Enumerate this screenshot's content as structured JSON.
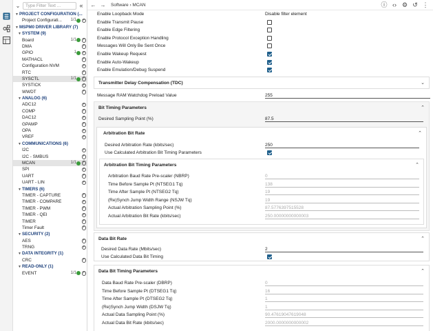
{
  "activity": {
    "icons": [
      "config-icon",
      "components-icon",
      "board-icon"
    ]
  },
  "sidebar": {
    "filter_placeholder": "Type Filter Text ...",
    "rows": [
      {
        "type": "cat",
        "label": "PROJECT CONFIGURATION (...",
        "arrow": "▼"
      },
      {
        "type": "item",
        "label": "Project Configurati...",
        "count": "1/1",
        "ok": true,
        "add": true
      },
      {
        "type": "cat",
        "label": "MSPM0 DRIVER LIBRARY (7)",
        "arrow": "▼"
      },
      {
        "type": "cat",
        "label": "SYSTEM (9)",
        "arrow": "▼",
        "indent": 1
      },
      {
        "type": "item",
        "label": "Board",
        "count": "1/1",
        "ok": true,
        "add": true
      },
      {
        "type": "item",
        "label": "DMA",
        "add": true
      },
      {
        "type": "item",
        "label": "GPIO",
        "count": "1",
        "ok": true,
        "add": true
      },
      {
        "type": "item",
        "label": "MATHACL",
        "add": true
      },
      {
        "type": "item",
        "label": "Configuration NVM",
        "add": true
      },
      {
        "type": "item",
        "label": "RTC",
        "add": true
      },
      {
        "type": "item",
        "label": "SYSCTL",
        "count": "1/1",
        "ok": true,
        "add": true,
        "selected": true
      },
      {
        "type": "item",
        "label": "SYSTICK",
        "add": true
      },
      {
        "type": "item",
        "label": "WWDT",
        "add": true
      },
      {
        "type": "cat",
        "label": "ANALOG (6)",
        "arrow": "▼",
        "indent": 1
      },
      {
        "type": "item",
        "label": "ADC12",
        "add": true
      },
      {
        "type": "item",
        "label": "COMP",
        "add": true
      },
      {
        "type": "item",
        "label": "DAC12",
        "add": true
      },
      {
        "type": "item",
        "label": "GPAMP",
        "add": true
      },
      {
        "type": "item",
        "label": "OPA",
        "add": true
      },
      {
        "type": "item",
        "label": "VREF",
        "add": true
      },
      {
        "type": "cat",
        "label": "COMMUNICATIONS (6)",
        "arrow": "▼",
        "indent": 1
      },
      {
        "type": "item",
        "label": "I2C",
        "add": true
      },
      {
        "type": "item",
        "label": "I2C - SMBUS",
        "add": true
      },
      {
        "type": "item",
        "label": "MCAN",
        "count": "1/1",
        "ok": true,
        "add": true,
        "selected": true
      },
      {
        "type": "item",
        "label": "SPI",
        "add": true
      },
      {
        "type": "item",
        "label": "UART",
        "add": true
      },
      {
        "type": "item",
        "label": "UART - LIN",
        "add": true
      },
      {
        "type": "cat",
        "label": "TIMERS (6)",
        "arrow": "▼",
        "indent": 1
      },
      {
        "type": "item",
        "label": "TIMER - CAPTURE",
        "add": true
      },
      {
        "type": "item",
        "label": "TIMER - COMPARE",
        "add": true
      },
      {
        "type": "item",
        "label": "TIMER - PWM",
        "add": true
      },
      {
        "type": "item",
        "label": "TIMER - QEI",
        "add": true
      },
      {
        "type": "item",
        "label": "TIMER",
        "add": true
      },
      {
        "type": "item",
        "label": "Timer Fault",
        "add": true
      },
      {
        "type": "cat",
        "label": "SECURITY (2)",
        "arrow": "▼",
        "indent": 1
      },
      {
        "type": "item",
        "label": "AES",
        "add": true
      },
      {
        "type": "item",
        "label": "TRNG",
        "add": true
      },
      {
        "type": "cat",
        "label": "DATA INTEGRITY (1)",
        "arrow": "▼",
        "indent": 1
      },
      {
        "type": "item",
        "label": "CRC",
        "add": true
      },
      {
        "type": "cat",
        "label": "READ-ONLY (1)",
        "arrow": "▼",
        "indent": 1
      },
      {
        "type": "item",
        "label": "EVENT",
        "count": "1/1",
        "ok": true,
        "add": true
      }
    ]
  },
  "topbar": {
    "breadcrumb": "Software › MCAN"
  },
  "main": {
    "top_rows": [
      {
        "label": "Enable Loopback Mode",
        "kind": "select",
        "value": "Disable filter element"
      },
      {
        "label": "Enable Transmit Pause",
        "kind": "checkbox",
        "checked": false
      },
      {
        "label": "Enable Edge Filtering",
        "kind": "checkbox",
        "checked": false
      },
      {
        "label": "Enable Protocol Exception Handling",
        "kind": "checkbox",
        "checked": false
      },
      {
        "label": "Messages Will Only Be Sent Once",
        "kind": "checkbox",
        "checked": false
      },
      {
        "label": "Enable Wakeup Request",
        "kind": "checkbox",
        "checked": true
      },
      {
        "label": "Enable Auto-Wakeup",
        "kind": "checkbox",
        "checked": true
      },
      {
        "label": "Enable Emulation/Debug Suspend",
        "kind": "checkbox",
        "checked": true
      }
    ],
    "tdc_title": "Transmitter Delay Compensation (TDC)",
    "watchdog_label": "Message RAM Watchdog Preload Value",
    "watchdog_value": "255",
    "bit_timing_title": "Bit Timing Parameters",
    "sampling_label": "Desired Sampling Point (%)",
    "sampling_value": "87.5",
    "arb_title": "Arbitration Bit Rate",
    "arb_rate_label": "Desired Arbitration Rate (kbits/sec)",
    "arb_rate_value": "250",
    "arb_calc_label": "Use Calculated Arbitration Bit Timing Parameters",
    "arb_params_title": "Arbitration Bit Timing Parameters",
    "arb_params": [
      {
        "label": "Arbitration Baud Rate Pre-scaler (NBRP)",
        "value": "0"
      },
      {
        "label": "Time Before Sample Pt (NTSEG1 Tq)",
        "value": "138"
      },
      {
        "label": "Time After Sample Pt (NTSEG2 Tq)",
        "value": "19"
      },
      {
        "label": "(Re)Synch Jump Width Range (NSJW Tq)",
        "value": "19"
      },
      {
        "label": "Actual Arbitration Sampling Point (%)",
        "value": "87.5776397515528"
      },
      {
        "label": "Actual Arbitration Bit Rate (kbits/sec)",
        "value": "250.00000000000003"
      }
    ],
    "data_title": "Data Bit Rate",
    "data_rate_label": "Desired Data Rate (Mbits/sec)",
    "data_rate_value": "2",
    "data_calc_label": "Use Calculated Data Bit Timing",
    "data_params_title": "Data Bit Timing Parameters",
    "data_params": [
      {
        "label": "Data Baud Rate Pre-scaler (DBRP)",
        "value": "0"
      },
      {
        "label": "Time Before Sample Pt (DTSEG1 Tq)",
        "value": "16"
      },
      {
        "label": "Time After Sample Pt (DTSEG2 Tq)",
        "value": "1"
      },
      {
        "label": "(Re)Synch Jump Width (DSJW Tq)",
        "value": "1"
      },
      {
        "label": "Actual Data Sampling Point (%)",
        "value": "90.47619047619048"
      },
      {
        "label": "Actual Data Bit Rate (kbits/sec)",
        "value": "2000.0000000000002"
      }
    ]
  }
}
